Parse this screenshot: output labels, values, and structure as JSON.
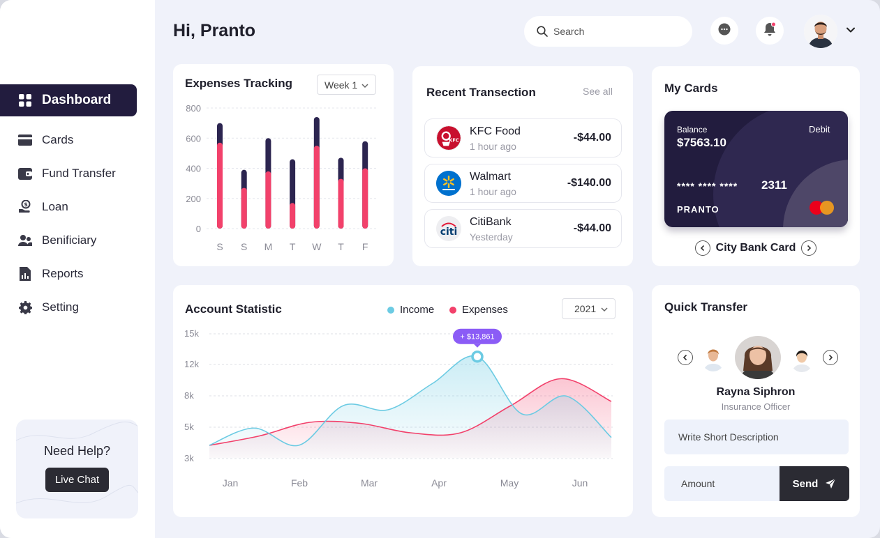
{
  "header": {
    "greeting": "Hi, Pranto",
    "search_placeholder": "Search"
  },
  "sidebar": {
    "items": [
      {
        "label": "Dashboard",
        "icon": "grid-icon",
        "active": true
      },
      {
        "label": "Cards",
        "icon": "card-icon"
      },
      {
        "label": "Fund Transfer",
        "icon": "wallet-icon"
      },
      {
        "label": "Loan",
        "icon": "hand-coin-icon"
      },
      {
        "label": "Benificiary",
        "icon": "users-icon"
      },
      {
        "label": "Reports",
        "icon": "report-icon"
      },
      {
        "label": "Setting",
        "icon": "gear-icon"
      }
    ],
    "help": {
      "title": "Need Help?",
      "button": "Live Chat"
    }
  },
  "expenses": {
    "title": "Expenses Tracking",
    "week_selected": "Week 1",
    "chart_data": {
      "type": "bar",
      "categories": [
        "S",
        "S",
        "M",
        "T",
        "W",
        "T",
        "F"
      ],
      "y_ticks": [
        "800",
        "600",
        "400",
        "200",
        "0"
      ],
      "ylim": [
        0,
        800
      ],
      "series": [
        {
          "values": [
            570,
            270,
            380,
            170,
            550,
            330,
            400
          ],
          "color": "#f2416b"
        },
        {
          "values": [
            700,
            390,
            600,
            460,
            740,
            470,
            580
          ],
          "color": "#2c2550"
        }
      ]
    }
  },
  "transactions": {
    "title": "Recent Transection",
    "see_all": "See all",
    "items": [
      {
        "name": "KFC Food",
        "time": "1 hour ago",
        "amount": "-$44.00",
        "logo": "kfc-logo"
      },
      {
        "name": "Walmart",
        "time": "1 hour ago",
        "amount": "-$140.00",
        "logo": "walmart-logo"
      },
      {
        "name": "CitiBank",
        "time": "Yesterday",
        "amount": "-$44.00",
        "logo": "citi-logo"
      }
    ]
  },
  "my_cards": {
    "title": "My Cards",
    "balance_label": "Balance",
    "balance": "$7563.10",
    "type": "Debit",
    "number_mask": "**** **** ****",
    "last4": "2311",
    "holder": "PRANTO",
    "card_name": "City Bank Card"
  },
  "statistic": {
    "title": "Account Statistic",
    "legend": [
      {
        "label": "Income",
        "color": "#6ccbe3"
      },
      {
        "label": "Expenses",
        "color": "#f2416b"
      }
    ],
    "year_selected": "2021",
    "tooltip": "+ $13,861",
    "chart_data": {
      "type": "line",
      "x": [
        "Jan",
        "Feb",
        "Mar",
        "Apr",
        "May",
        "Jun"
      ],
      "y_ticks": [
        "15k",
        "12k",
        "8k",
        "5k",
        "3k"
      ],
      "series": [
        {
          "name": "Income",
          "color": "#6ccbe3",
          "values": [
            3800,
            4900,
            3800,
            7000,
            6600,
            9500,
            12700,
            6200,
            7900,
            4300
          ]
        },
        {
          "name": "Expenses",
          "color": "#f2416b",
          "values": [
            3800,
            4400,
            5400,
            5300,
            4600,
            4600,
            7000,
            10100,
            7400
          ]
        }
      ],
      "highlight": {
        "month": "Apr",
        "value": 13861
      }
    }
  },
  "quick_transfer": {
    "title": "Quick Transfer",
    "selected_name": "Rayna Siphron",
    "selected_role": "Insurance Officer",
    "description_placeholder": "Write Short Description",
    "amount_placeholder": "Amount",
    "send_label": "Send"
  }
}
